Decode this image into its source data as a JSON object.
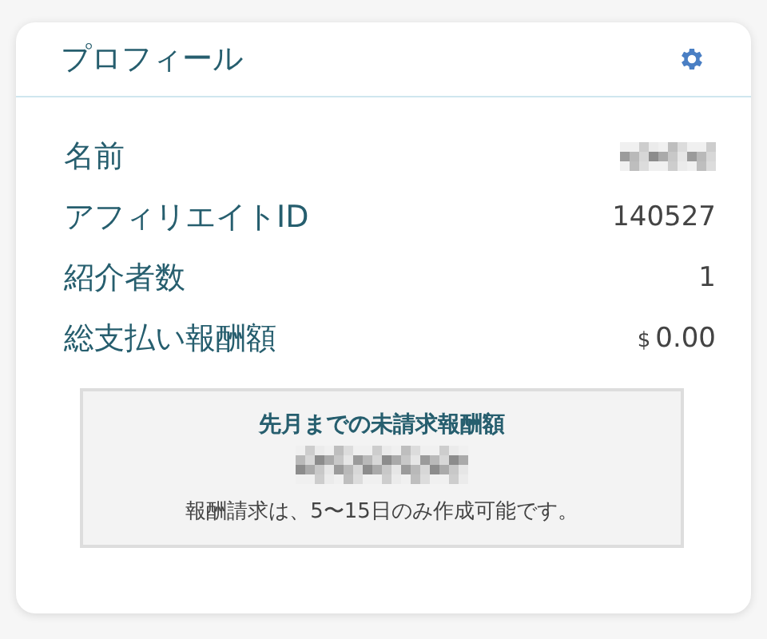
{
  "card": {
    "title": "プロフィール"
  },
  "fields": [
    {
      "label": "名前",
      "kind": "redacted"
    },
    {
      "label": "アフィリエイトID",
      "kind": "text",
      "value": "140527"
    },
    {
      "label": "紹介者数",
      "kind": "text",
      "value": "1"
    },
    {
      "label": "総支払い報酬額",
      "kind": "money",
      "currency": "$",
      "value": "0.00"
    }
  ],
  "unpaid": {
    "title": "先月までの未請求報酬額",
    "amount_redacted": true,
    "note": "報酬請求は、5〜15日のみ作成可能です。"
  }
}
